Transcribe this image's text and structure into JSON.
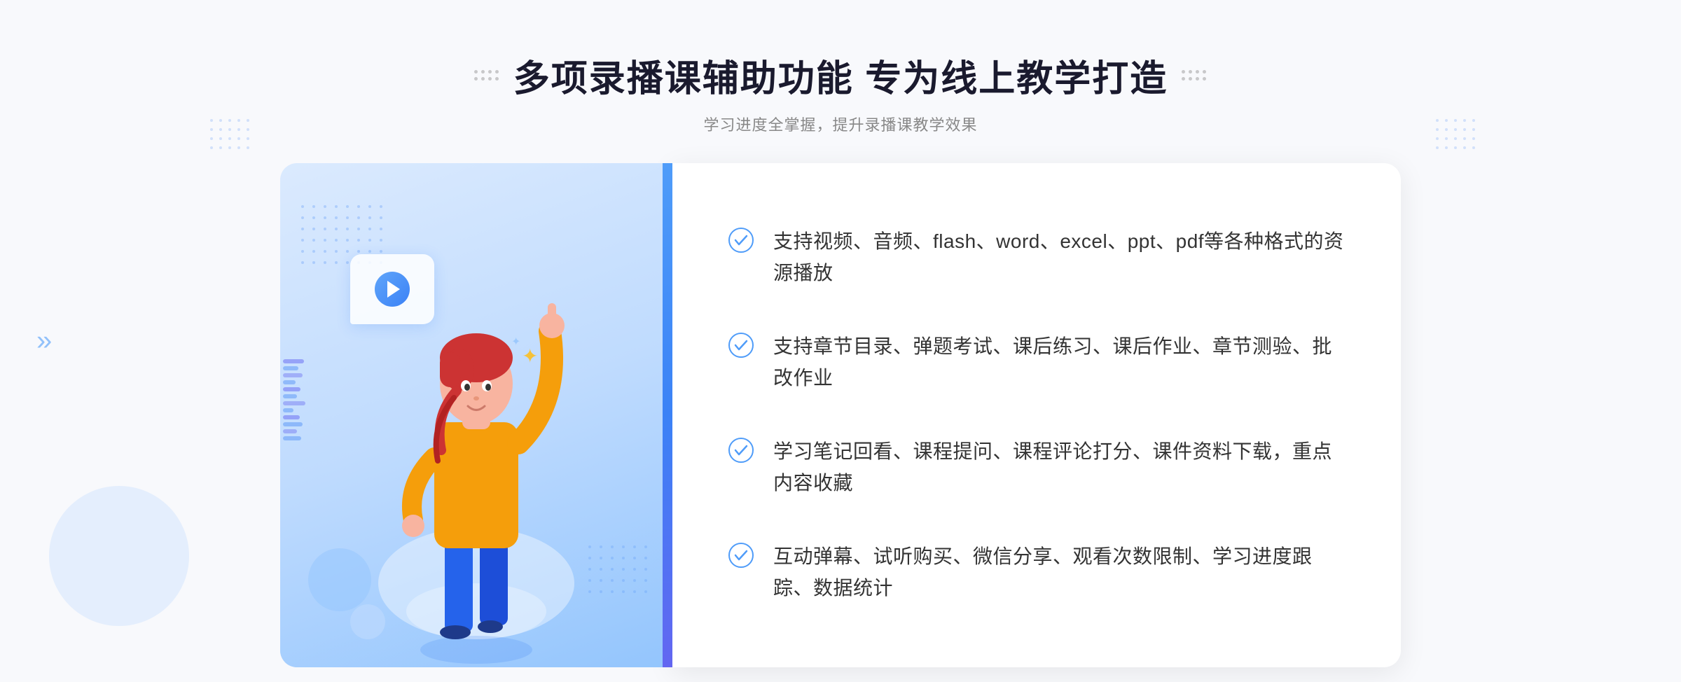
{
  "page": {
    "background_color": "#f8f9fc"
  },
  "header": {
    "title": "多项录播课辅助功能 专为线上教学打造",
    "subtitle": "学习进度全掌握，提升录播课教学效果"
  },
  "features": [
    {
      "id": 1,
      "text": "支持视频、音频、flash、word、excel、ppt、pdf等各种格式的资源播放"
    },
    {
      "id": 2,
      "text": "支持章节目录、弹题考试、课后练习、课后作业、章节测验、批改作业"
    },
    {
      "id": 3,
      "text": "学习笔记回看、课程提问、课程评论打分、课件资料下载，重点内容收藏"
    },
    {
      "id": 4,
      "text": "互动弹幕、试听购买、微信分享、观看次数限制、学习进度跟踪、数据统计"
    }
  ],
  "icons": {
    "check_circle": "check-circle-icon",
    "play": "play-icon",
    "chevron_right": "»"
  },
  "colors": {
    "primary": "#3b82f6",
    "title": "#1a1a2e",
    "subtitle": "#888888",
    "text": "#333333",
    "check": "#4f9cf9",
    "panel_bg": "#dbeafe"
  }
}
